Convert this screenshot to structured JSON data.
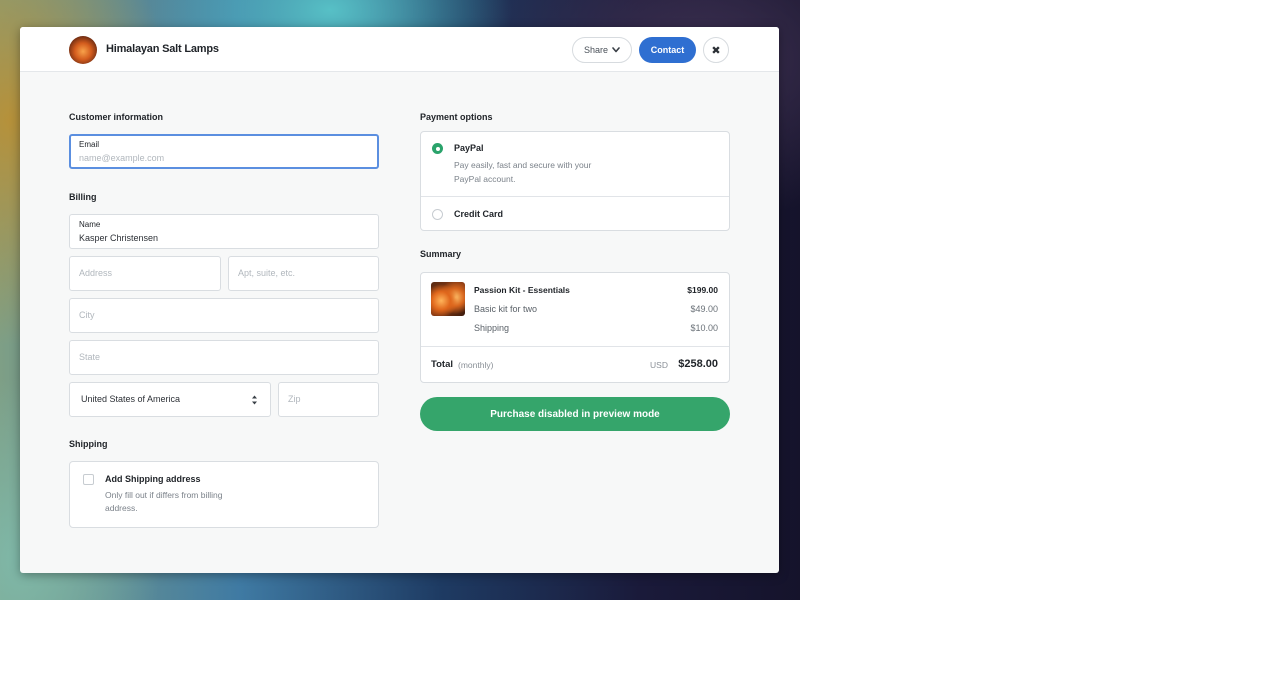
{
  "header": {
    "store_name": "Himalayan Salt Lamps",
    "share_label": "Share",
    "contact_label": "Contact",
    "close_symbol": "✖"
  },
  "customer": {
    "title": "Customer information",
    "email_label": "Email",
    "email_placeholder": "name@example.com"
  },
  "billing": {
    "title": "Billing",
    "name_label": "Name",
    "name_value": "Kasper Christensen",
    "address_placeholder": "Address",
    "apt_placeholder": "Apt, suite, etc.",
    "city_placeholder": "City",
    "state_placeholder": "State",
    "country_value": "United States of America",
    "zip_placeholder": "Zip"
  },
  "shipping": {
    "title": "Shipping",
    "checkbox_label": "Add Shipping address",
    "hint_line1": "Only fill out if differs from billing",
    "hint_line2": "address."
  },
  "payment": {
    "title": "Payment options",
    "paypal_label": "PayPal",
    "paypal_desc_line1": "Pay easily, fast and secure with your",
    "paypal_desc_line2": "PayPal account.",
    "paypal_selected": true,
    "credit_card_label": "Credit Card"
  },
  "summary": {
    "title": "Summary",
    "product_name": "Passion Kit - Essentials",
    "product_price": "$199.00",
    "items": [
      {
        "label": "Basic kit for two",
        "price": "$49.00"
      },
      {
        "label": "Shipping",
        "price": "$10.00"
      }
    ],
    "total_label": "Total",
    "total_period": "(monthly)",
    "currency": "USD",
    "total_amount": "$258.00"
  },
  "purchase_button_label": "Purchase disabled in preview mode",
  "colors": {
    "accent_blue": "#2f6fd1",
    "purchase_green": "#35a56b",
    "focus_border": "#5b8fe0"
  }
}
